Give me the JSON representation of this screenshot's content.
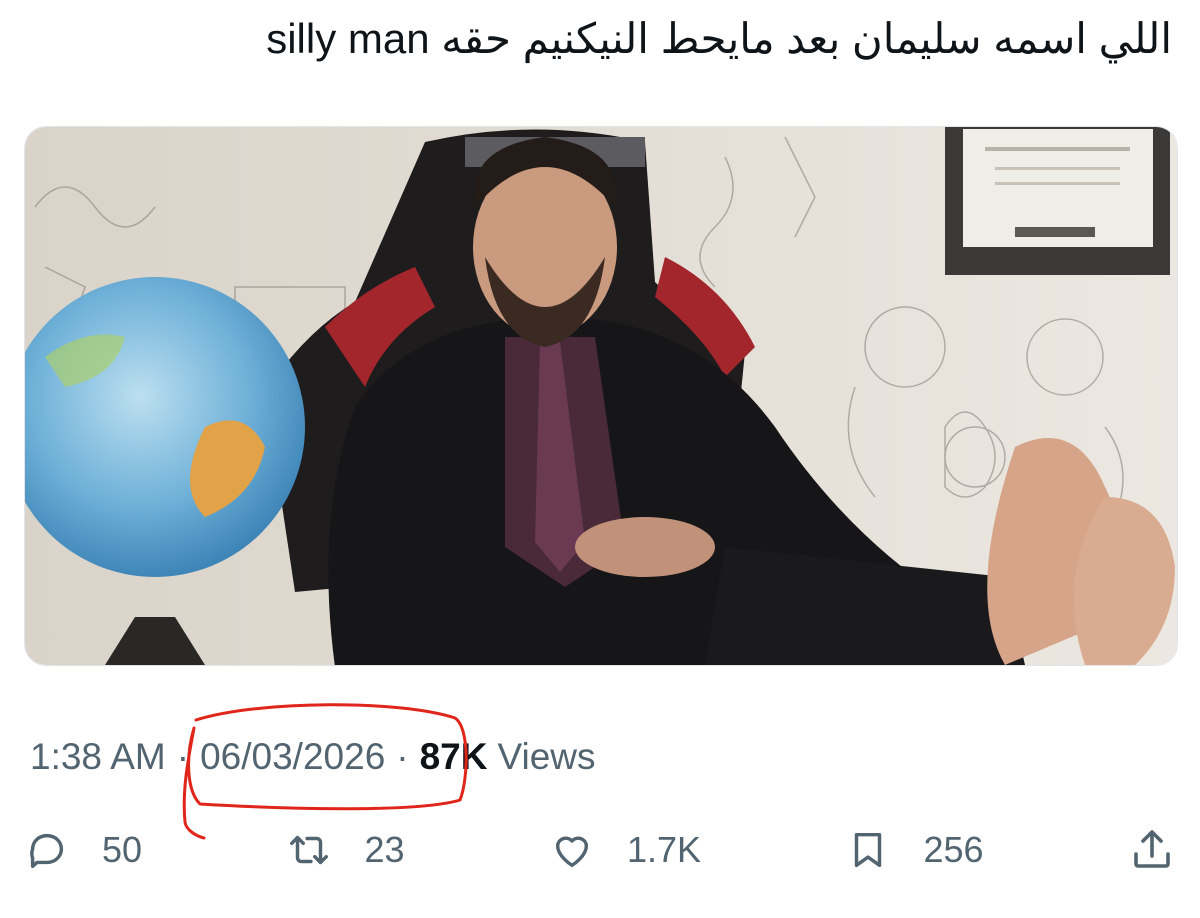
{
  "tweet": {
    "text": "اللي اسمه سليمان بعد مايحط النيكنيم حقه silly man"
  },
  "meta": {
    "time": "1:38 AM",
    "separator": "·",
    "date": "06/03/2026",
    "views_count": "87K",
    "views_label": "Views"
  },
  "actions": {
    "replies": "50",
    "reposts": "23",
    "likes": "1.7K",
    "bookmarks": "256"
  },
  "icons": {
    "reply": "reply-icon",
    "repost": "repost-icon",
    "like": "heart-icon",
    "bookmark": "bookmark-icon",
    "share": "share-icon"
  },
  "colors": {
    "text": "#0f1419",
    "muted": "#536471",
    "annotation": "#e0251b"
  }
}
